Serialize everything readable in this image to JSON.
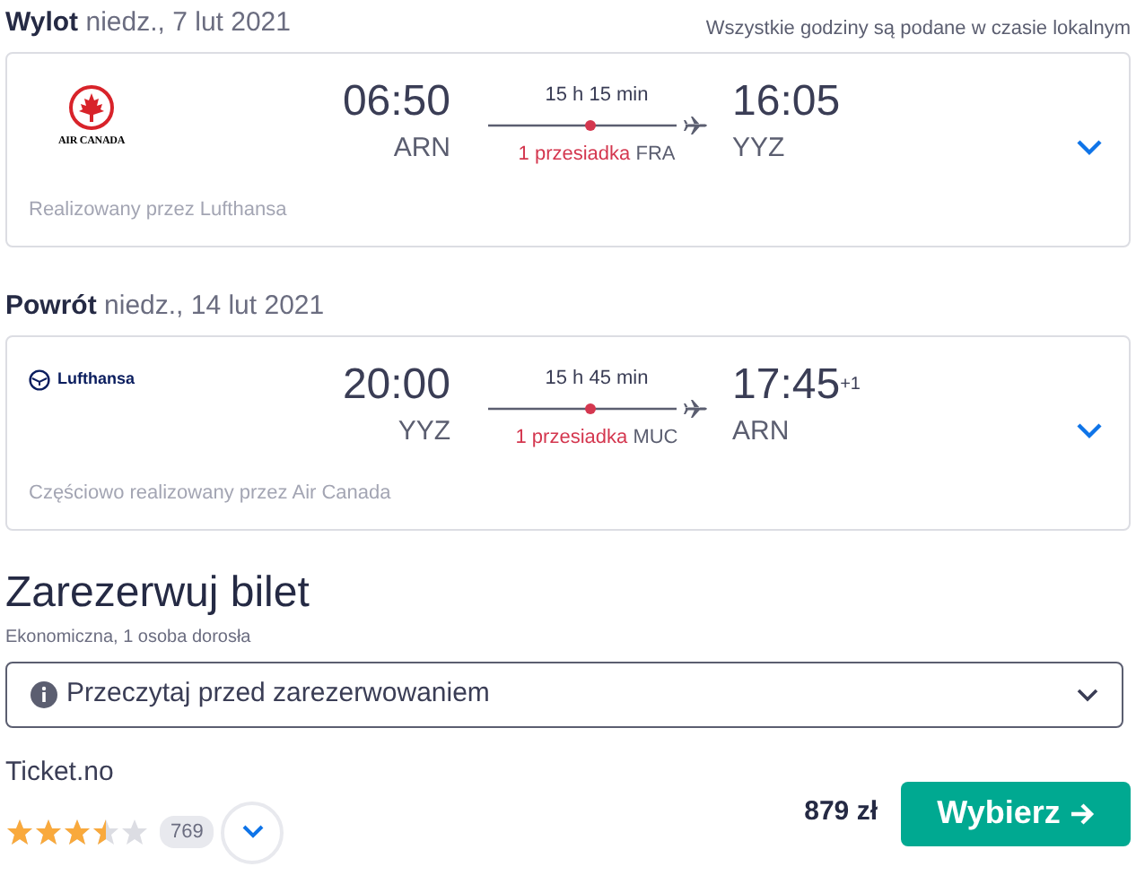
{
  "legs": [
    {
      "label": "Wylot",
      "date": "niedz., 7 lut 2021",
      "note": "Wszystkie godziny są podane w czasie lokalnym",
      "airline": {
        "kind": "maple",
        "logo_text": "AIR CANADA"
      },
      "depart_time": "06:50",
      "depart_code": "ARN",
      "duration": "15 h 15 min",
      "stops": "1 przesiadka",
      "stop_code": "FRA",
      "arrive_time": "16:05",
      "arrive_code": "YYZ",
      "operated": "Realizowany przez Lufthansa"
    },
    {
      "label": "Powrót",
      "date": "niedz., 14 lut 2021",
      "airline": {
        "kind": "crane",
        "logo_text": "Lufthansa"
      },
      "depart_time": "20:00",
      "depart_code": "YYZ",
      "duration": "15 h 45 min",
      "stops": "1 przesiadka",
      "stop_code": "MUC",
      "arrive_time": "17:45",
      "arrive_offset": "+1",
      "arrive_code": "ARN",
      "operated": "Częściowo realizowany przez Air Canada"
    }
  ],
  "booking": {
    "title": "Zarezerwuj bilet",
    "subtitle": "Ekonomiczna, 1 osoba dorosła",
    "notice": "Przeczytaj przed zarezerwowaniem"
  },
  "offer": {
    "provider": "Ticket.no",
    "stars": 3.5,
    "reviews": "769",
    "price": "879 zł",
    "button": "Wybierz"
  }
}
